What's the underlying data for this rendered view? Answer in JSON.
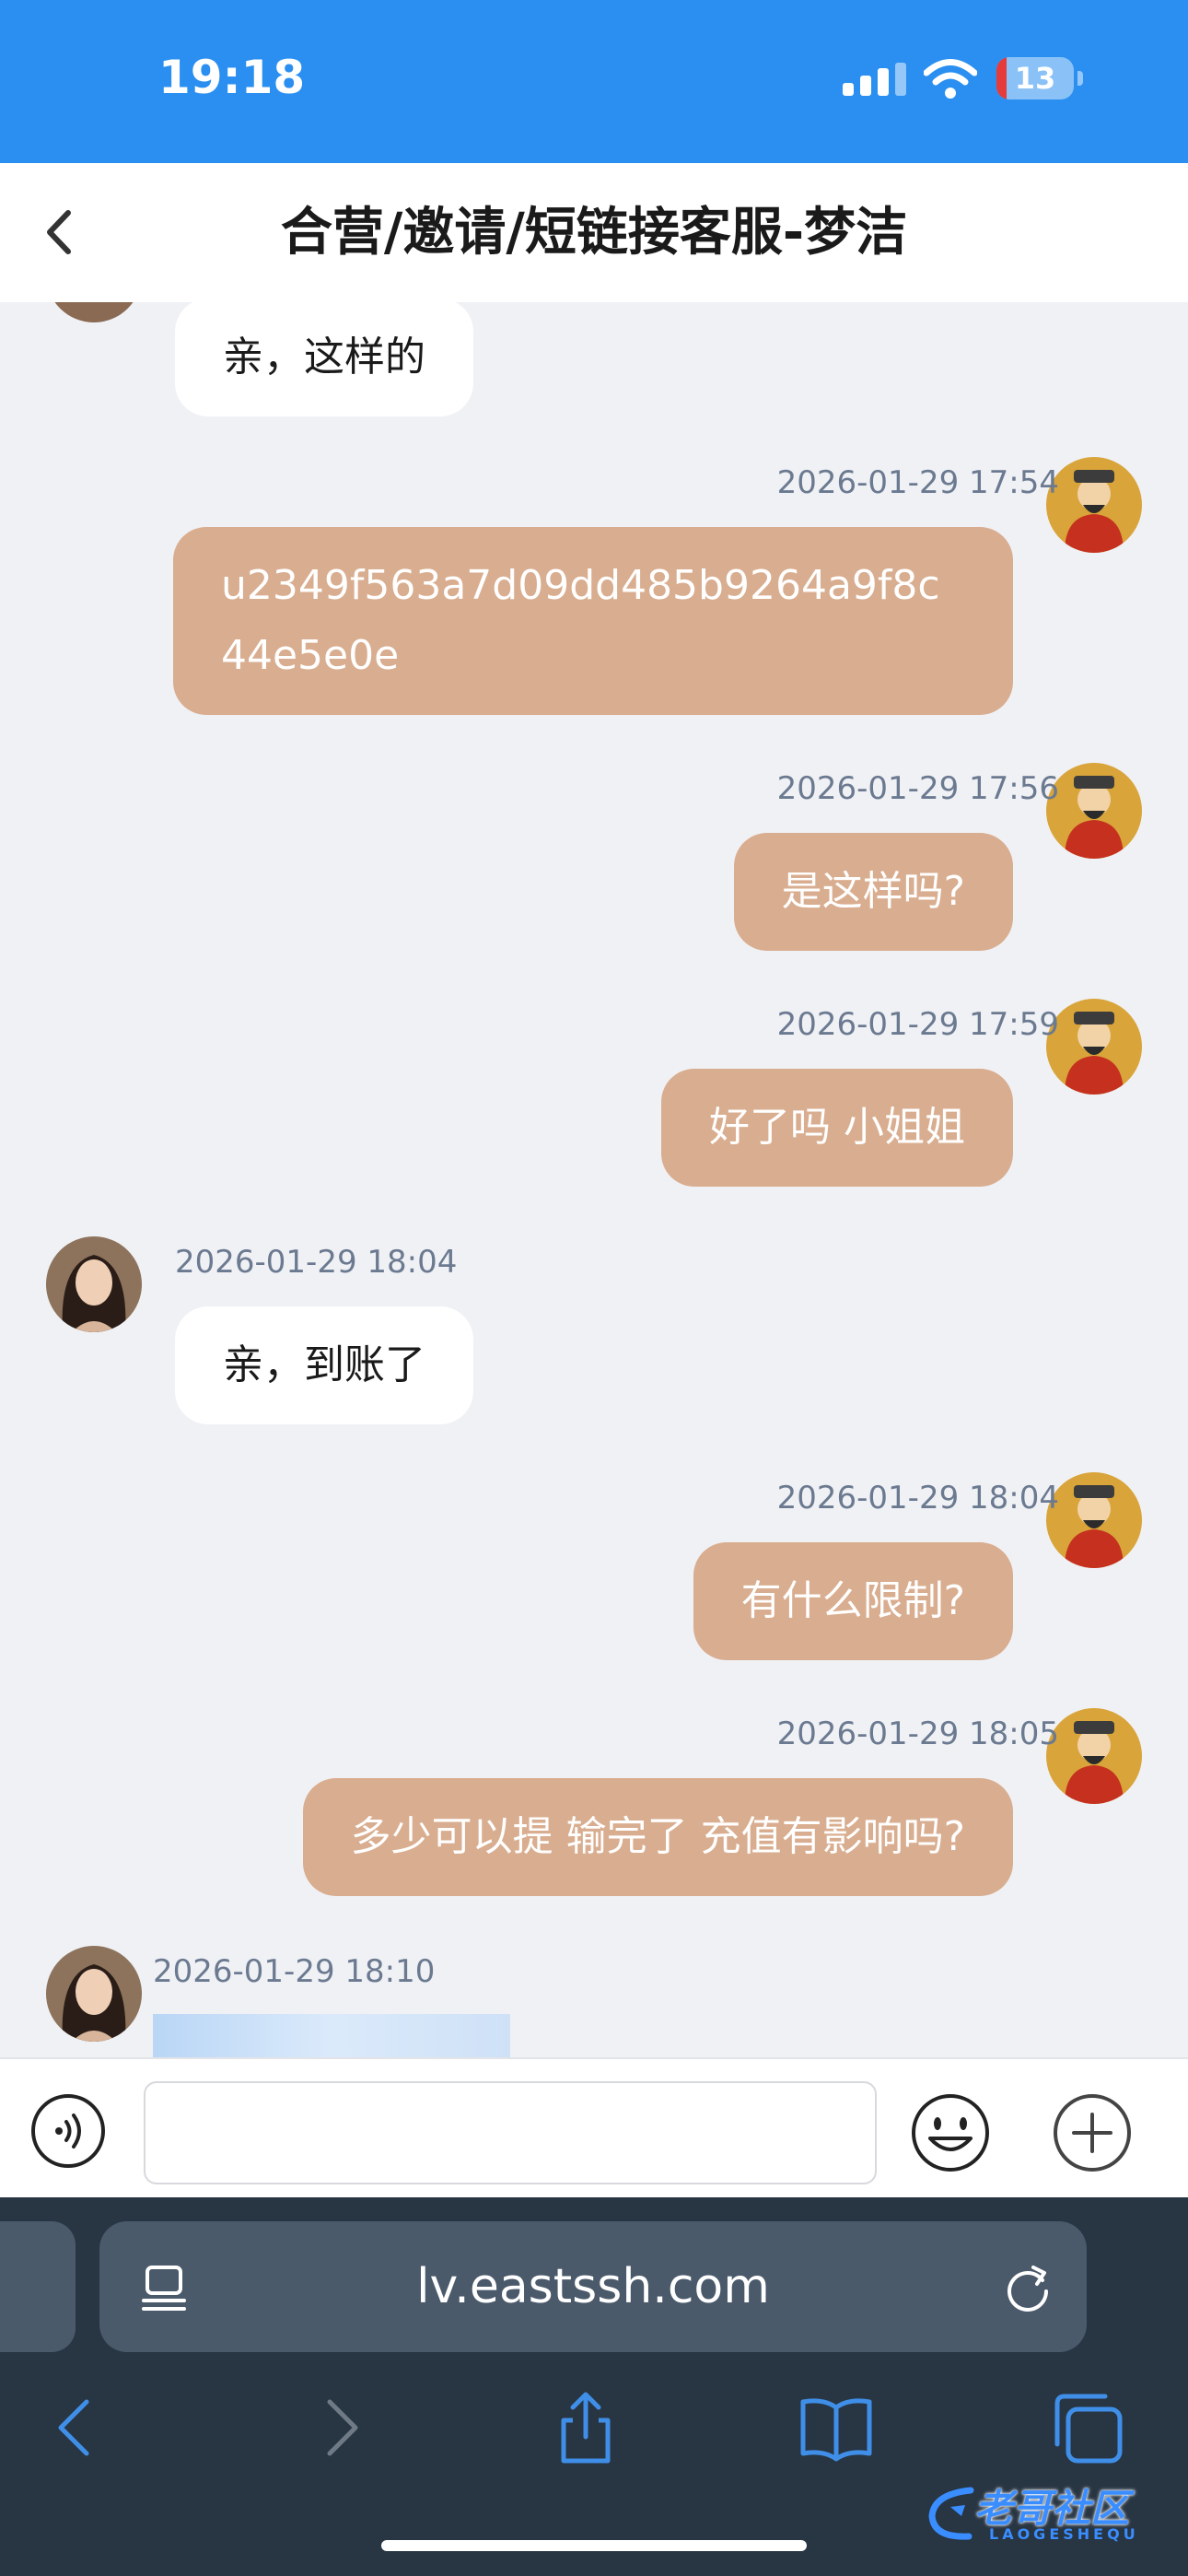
{
  "status_bar": {
    "time": "19:18",
    "battery": "13",
    "battery_level": 0.13
  },
  "header": {
    "title": "合营/邀请/短链接客服-梦洁"
  },
  "messages": [
    {
      "side": "in",
      "text": "亲，这样的"
    },
    {
      "side": "out",
      "time": "2026-01-29 17:54",
      "text": "u2349f563a7d09dd485b9264a9f8c44e5e0e"
    },
    {
      "side": "out",
      "time": "2026-01-29 17:56",
      "text": "是这样吗?"
    },
    {
      "side": "out",
      "time": "2026-01-29 17:59",
      "text": "好了吗 小姐姐"
    },
    {
      "side": "in",
      "time": "2026-01-29 18:04",
      "text": "亲，到账了"
    },
    {
      "side": "out",
      "time": "2026-01-29 18:04",
      "text": "有什么限制?"
    },
    {
      "side": "out",
      "time": "2026-01-29 18:05",
      "text": "多少可以提 输完了 充值有影响吗?"
    },
    {
      "side": "in",
      "time": "2026-01-29 18:10",
      "text": ""
    }
  ],
  "input": {
    "value": "",
    "placeholder": ""
  },
  "browser": {
    "url": "lv.eastssh.com"
  },
  "watermark": {
    "text": "老哥社区",
    "sub": "LAOGESHEQU"
  },
  "icons": {
    "back": "chevron-left-icon",
    "voice": "voice-icon",
    "emoji": "smiley-icon",
    "plus": "plus-circle-icon",
    "page": "page-menu-icon",
    "reload": "reload-icon",
    "nav_back": "chevron-left-icon",
    "nav_forward": "chevron-right-icon",
    "share": "share-icon",
    "bookmarks": "book-icon",
    "tabs": "tabs-icon"
  },
  "colors": {
    "status_bar": "#2a8ff0",
    "outgoing_bubble": "#d9ad8f",
    "incoming_bubble": "#ffffff",
    "chat_bg": "#f0f1f5",
    "browser_bg": "#283543",
    "browser_accent": "#3f8fe8"
  }
}
